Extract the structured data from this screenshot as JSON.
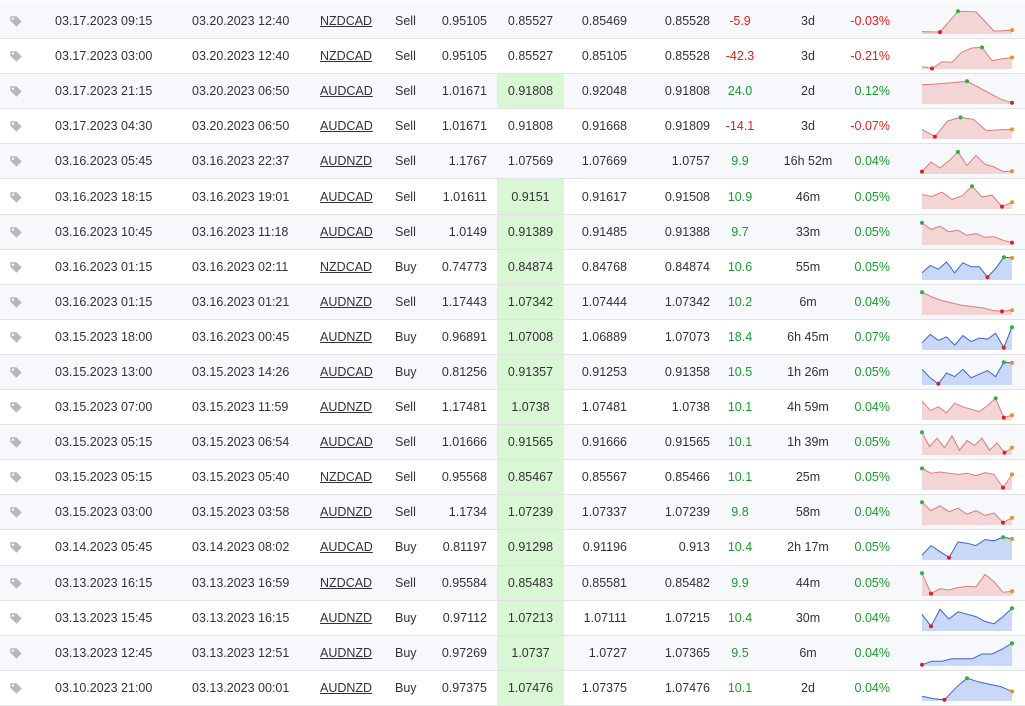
{
  "colors": {
    "positive": "#1a9b2c",
    "negative": "#e02020",
    "highlight": "#d9f7d4",
    "sell_fill": "#f3d5d5",
    "sell_line": "#e07b7b",
    "buy_fill": "#c9d8f7",
    "buy_line": "#3d63d6",
    "max_marker": "#2ab534",
    "min_marker": "#e02020",
    "end_marker": "#f28c28"
  },
  "icons": {
    "row_tag": "tag-icon"
  },
  "trades": [
    {
      "open": "03.17.2023 09:15",
      "close": "03.20.2023 12:40",
      "symbol": "NZDCAD",
      "dir": "Sell",
      "p1": "0.95105",
      "p2": "0.85527",
      "p3": "0.85469",
      "p4": "0.85528",
      "pips": "-5.9",
      "dur": "3d",
      "pct": "-0.03%",
      "hl": false
    },
    {
      "open": "03.17.2023 03:00",
      "close": "03.20.2023 12:40",
      "symbol": "NZDCAD",
      "dir": "Sell",
      "p1": "0.95105",
      "p2": "0.85527",
      "p3": "0.85105",
      "p4": "0.85528",
      "pips": "-42.3",
      "dur": "3d",
      "pct": "-0.21%",
      "hl": false
    },
    {
      "open": "03.17.2023 21:15",
      "close": "03.20.2023 06:50",
      "symbol": "AUDCAD",
      "dir": "Sell",
      "p1": "1.01671",
      "p2": "0.91808",
      "p3": "0.92048",
      "p4": "0.91808",
      "pips": "24.0",
      "dur": "2d",
      "pct": "0.12%",
      "hl": true
    },
    {
      "open": "03.17.2023 04:30",
      "close": "03.20.2023 06:50",
      "symbol": "AUDCAD",
      "dir": "Sell",
      "p1": "1.01671",
      "p2": "0.91808",
      "p3": "0.91668",
      "p4": "0.91809",
      "pips": "-14.1",
      "dur": "3d",
      "pct": "-0.07%",
      "hl": false
    },
    {
      "open": "03.16.2023 05:45",
      "close": "03.16.2023 22:37",
      "symbol": "AUDNZD",
      "dir": "Sell",
      "p1": "1.1767",
      "p2": "1.07569",
      "p3": "1.07669",
      "p4": "1.0757",
      "pips": "9.9",
      "dur": "16h 52m",
      "pct": "0.04%",
      "hl": false
    },
    {
      "open": "03.16.2023 18:15",
      "close": "03.16.2023 19:01",
      "symbol": "AUDCAD",
      "dir": "Sell",
      "p1": "1.01611",
      "p2": "0.9151",
      "p3": "0.91617",
      "p4": "0.91508",
      "pips": "10.9",
      "dur": "46m",
      "pct": "0.05%",
      "hl": true
    },
    {
      "open": "03.16.2023 10:45",
      "close": "03.16.2023 11:18",
      "symbol": "AUDCAD",
      "dir": "Sell",
      "p1": "1.0149",
      "p2": "0.91389",
      "p3": "0.91485",
      "p4": "0.91388",
      "pips": "9.7",
      "dur": "33m",
      "pct": "0.05%",
      "hl": true
    },
    {
      "open": "03.16.2023 01:15",
      "close": "03.16.2023 02:11",
      "symbol": "NZDCAD",
      "dir": "Buy",
      "p1": "0.74773",
      "p2": "0.84874",
      "p3": "0.84768",
      "p4": "0.84874",
      "pips": "10.6",
      "dur": "55m",
      "pct": "0.05%",
      "hl": true
    },
    {
      "open": "03.16.2023 01:15",
      "close": "03.16.2023 01:21",
      "symbol": "AUDNZD",
      "dir": "Sell",
      "p1": "1.17443",
      "p2": "1.07342",
      "p3": "1.07444",
      "p4": "1.07342",
      "pips": "10.2",
      "dur": "6m",
      "pct": "0.04%",
      "hl": true
    },
    {
      "open": "03.15.2023 18:00",
      "close": "03.16.2023 00:45",
      "symbol": "AUDNZD",
      "dir": "Buy",
      "p1": "0.96891",
      "p2": "1.07008",
      "p3": "1.06889",
      "p4": "1.07073",
      "pips": "18.4",
      "dur": "6h 45m",
      "pct": "0.07%",
      "hl": true
    },
    {
      "open": "03.15.2023 13:00",
      "close": "03.15.2023 14:26",
      "symbol": "AUDCAD",
      "dir": "Buy",
      "p1": "0.81256",
      "p2": "0.91357",
      "p3": "0.91253",
      "p4": "0.91358",
      "pips": "10.5",
      "dur": "1h 26m",
      "pct": "0.05%",
      "hl": true
    },
    {
      "open": "03.15.2023 07:00",
      "close": "03.15.2023 11:59",
      "symbol": "AUDNZD",
      "dir": "Sell",
      "p1": "1.17481",
      "p2": "1.0738",
      "p3": "1.07481",
      "p4": "1.0738",
      "pips": "10.1",
      "dur": "4h 59m",
      "pct": "0.04%",
      "hl": true
    },
    {
      "open": "03.15.2023 05:15",
      "close": "03.15.2023 06:54",
      "symbol": "AUDCAD",
      "dir": "Sell",
      "p1": "1.01666",
      "p2": "0.91565",
      "p3": "0.91666",
      "p4": "0.91565",
      "pips": "10.1",
      "dur": "1h 39m",
      "pct": "0.05%",
      "hl": true
    },
    {
      "open": "03.15.2023 05:15",
      "close": "03.15.2023 05:40",
      "symbol": "NZDCAD",
      "dir": "Sell",
      "p1": "0.95568",
      "p2": "0.85467",
      "p3": "0.85567",
      "p4": "0.85466",
      "pips": "10.1",
      "dur": "25m",
      "pct": "0.05%",
      "hl": true
    },
    {
      "open": "03.15.2023 03:00",
      "close": "03.15.2023 03:58",
      "symbol": "AUDNZD",
      "dir": "Sell",
      "p1": "1.1734",
      "p2": "1.07239",
      "p3": "1.07337",
      "p4": "1.07239",
      "pips": "9.8",
      "dur": "58m",
      "pct": "0.04%",
      "hl": true
    },
    {
      "open": "03.14.2023 05:45",
      "close": "03.14.2023 08:02",
      "symbol": "AUDCAD",
      "dir": "Buy",
      "p1": "0.81197",
      "p2": "0.91298",
      "p3": "0.91196",
      "p4": "0.913",
      "pips": "10.4",
      "dur": "2h 17m",
      "pct": "0.05%",
      "hl": true
    },
    {
      "open": "03.13.2023 16:15",
      "close": "03.13.2023 16:59",
      "symbol": "NZDCAD",
      "dir": "Sell",
      "p1": "0.95584",
      "p2": "0.85483",
      "p3": "0.85581",
      "p4": "0.85482",
      "pips": "9.9",
      "dur": "44m",
      "pct": "0.05%",
      "hl": true
    },
    {
      "open": "03.13.2023 15:45",
      "close": "03.13.2023 16:15",
      "symbol": "AUDNZD",
      "dir": "Buy",
      "p1": "0.97112",
      "p2": "1.07213",
      "p3": "1.07111",
      "p4": "1.07215",
      "pips": "10.4",
      "dur": "30m",
      "pct": "0.04%",
      "hl": true
    },
    {
      "open": "03.13.2023 12:45",
      "close": "03.13.2023 12:51",
      "symbol": "AUDNZD",
      "dir": "Buy",
      "p1": "0.97269",
      "p2": "1.0737",
      "p3": "1.0727",
      "p4": "1.07365",
      "pips": "9.5",
      "dur": "6m",
      "pct": "0.04%",
      "hl": true
    },
    {
      "open": "03.10.2023 21:00",
      "close": "03.13.2023 00:01",
      "symbol": "AUDNZD",
      "dir": "Buy",
      "p1": "0.97375",
      "p2": "1.07476",
      "p3": "1.07375",
      "p4": "1.07476",
      "pips": "10.1",
      "dur": "2d",
      "pct": "0.04%",
      "hl": true
    }
  ],
  "sparks": [
    [
      0.1,
      0.08,
      0.95,
      0.92,
      0.12,
      0.16
    ],
    [
      0.1,
      0.02,
      0.3,
      0.28,
      0.7,
      0.88,
      0.9,
      0.35,
      0.42,
      0.48
    ],
    [
      0.8,
      0.82,
      0.86,
      0.9,
      0.95,
      0.7,
      0.45,
      0.2,
      0.05
    ],
    [
      0.4,
      0.1,
      0.75,
      0.9,
      0.82,
      0.35,
      0.38,
      0.4
    ],
    [
      0.1,
      0.5,
      0.25,
      0.55,
      0.92,
      0.35,
      0.78,
      0.4,
      0.3,
      0.1,
      0.12
    ],
    [
      0.6,
      0.52,
      0.7,
      0.4,
      0.55,
      0.95,
      0.5,
      0.58,
      0.1,
      0.28
    ],
    [
      0.92,
      0.65,
      0.78,
      0.55,
      0.62,
      0.4,
      0.48,
      0.32,
      0.35,
      0.2,
      0.1
    ],
    [
      0.3,
      0.6,
      0.45,
      0.75,
      0.3,
      0.72,
      0.55,
      0.55,
      0.12,
      0.48,
      0.95,
      0.92
    ],
    [
      0.95,
      0.75,
      0.6,
      0.5,
      0.4,
      0.35,
      0.3,
      0.2,
      0.15,
      0.2
    ],
    [
      0.3,
      0.65,
      0.4,
      0.55,
      0.2,
      0.6,
      0.35,
      0.5,
      0.45,
      0.7,
      0.1,
      0.95
    ],
    [
      0.65,
      0.3,
      0.05,
      0.5,
      0.35,
      0.65,
      0.3,
      0.45,
      0.6,
      0.35,
      0.95,
      0.92
    ],
    [
      0.8,
      0.4,
      0.55,
      0.3,
      0.7,
      0.55,
      0.45,
      0.35,
      0.6,
      0.9,
      0.1,
      0.2
    ],
    [
      0.95,
      0.35,
      0.7,
      0.3,
      0.8,
      0.2,
      0.6,
      0.4,
      0.7,
      0.2,
      0.5,
      0.1,
      0.3
    ],
    [
      0.9,
      0.7,
      0.75,
      0.7,
      0.65,
      0.7,
      0.6,
      0.72,
      0.65,
      0.1,
      0.65
    ],
    [
      0.95,
      0.6,
      0.8,
      0.55,
      0.7,
      0.45,
      0.6,
      0.4,
      0.5,
      0.1,
      0.3
    ],
    [
      0.2,
      0.6,
      0.35,
      0.1,
      0.75,
      0.7,
      0.6,
      0.85,
      0.8,
      0.95,
      0.88
    ],
    [
      0.95,
      0.1,
      0.3,
      0.25,
      0.35,
      0.4,
      0.38,
      0.9,
      0.6,
      0.15,
      0.2
    ],
    [
      0.7,
      0.2,
      0.9,
      0.5,
      0.8,
      0.7,
      0.6,
      0.4,
      0.3,
      0.6,
      0.95
    ],
    [
      0.05,
      0.2,
      0.2,
      0.3,
      0.3,
      0.3,
      0.5,
      0.5,
      0.7,
      0.95
    ],
    [
      0.2,
      0.1,
      0.05,
      0.55,
      0.95,
      0.8,
      0.7,
      0.6,
      0.4
    ]
  ]
}
